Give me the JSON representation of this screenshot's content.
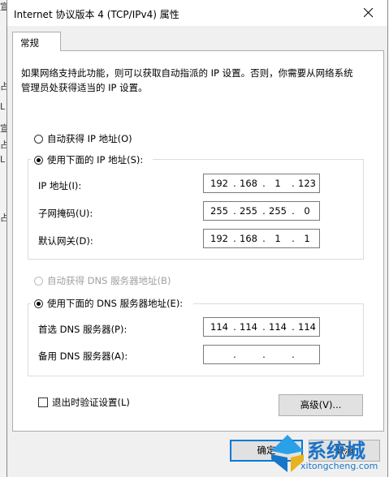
{
  "window": {
    "title": "Internet 协议版本 4 (TCP/IPv4) 属性"
  },
  "tabs": [
    {
      "label": "常规"
    }
  ],
  "description": "如果网络支持此功能，则可以获取自动指派的 IP 设置。否则，你需要从网络系统管理员处获得适当的 IP 设置。",
  "ip_section": {
    "auto_label": "自动获得 IP 地址(O)",
    "manual_label": "使用下面的 IP 地址(S):",
    "selected": "manual",
    "fields": [
      {
        "label": "IP 地址(I):",
        "octets": [
          "192",
          "168",
          "1",
          "123"
        ]
      },
      {
        "label": "子网掩码(U):",
        "octets": [
          "255",
          "255",
          "255",
          "0"
        ]
      },
      {
        "label": "默认网关(D):",
        "octets": [
          "192",
          "168",
          "1",
          "1"
        ]
      }
    ]
  },
  "dns_section": {
    "auto_label": "自动获得 DNS 服务器地址(B)",
    "manual_label": "使用下面的 DNS 服务器地址(E):",
    "selected": "manual",
    "fields": [
      {
        "label": "首选 DNS 服务器(P):",
        "octets": [
          "114",
          "114",
          "114",
          "114"
        ]
      },
      {
        "label": "备用 DNS 服务器(A):",
        "octets": [
          "",
          "",
          "",
          ""
        ]
      }
    ]
  },
  "validate_label": "退出时验证设置(L)",
  "advanced_label": "高级(V)...",
  "ok_label": "确定",
  "cancel_label": "取消",
  "watermark": {
    "brand": "系统城",
    "url": "xitongcheng.com"
  },
  "background_glyphs": [
    "宣",
    "占",
    "L",
    "宣",
    "占",
    "L",
    "占"
  ],
  "colors": {
    "accent": "#0078d7",
    "disabled": "#a0a0a0",
    "watermark": "#1a73c7"
  }
}
